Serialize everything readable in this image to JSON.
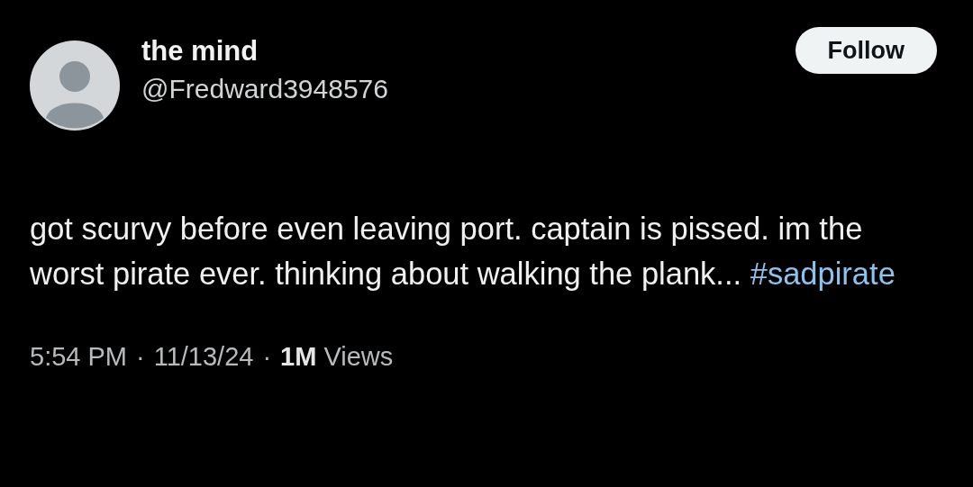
{
  "author": {
    "name": "the mind",
    "handle": "@Fredward3948576"
  },
  "follow_button": {
    "label": "Follow"
  },
  "post": {
    "text": "got scurvy before even leaving port. captain is pissed. im the worst pirate ever. thinking about walking the plank...",
    "hashtag": "#sadpirate"
  },
  "meta": {
    "time": "5:54 PM",
    "separator_1": "·",
    "date": "11/13/24",
    "separator_2": "·",
    "views_count": "1M",
    "views_label": "Views"
  }
}
